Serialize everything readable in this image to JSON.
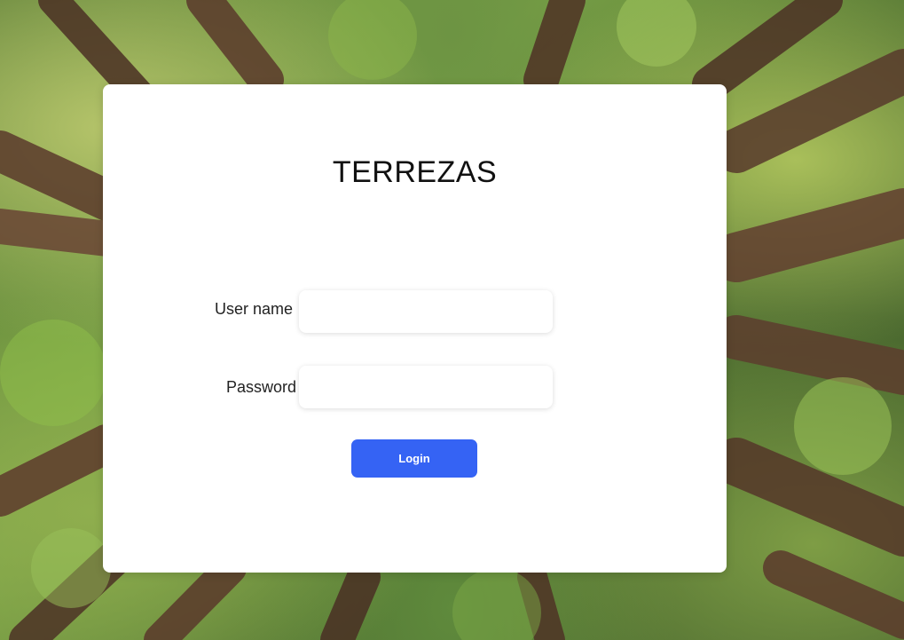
{
  "login_card": {
    "title": "TERREZAS",
    "username": {
      "label": "User name",
      "value": "",
      "placeholder": ""
    },
    "password": {
      "label": "Password",
      "value": "",
      "placeholder": ""
    },
    "login_button_label": "Login"
  },
  "colors": {
    "accent": "#3563f4",
    "card_background": "#ffffff"
  }
}
